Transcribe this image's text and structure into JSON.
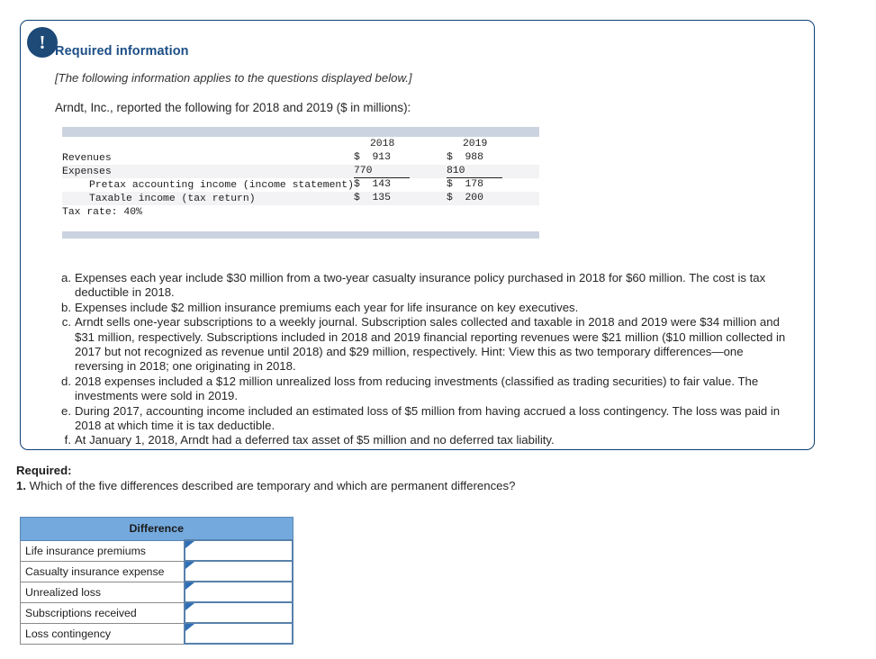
{
  "card": {
    "alert_icon": "exclamation-icon",
    "alert_glyph": "!",
    "heading": "Required information",
    "applies_note": "[The following information applies to the questions displayed below.]",
    "intro": "Arndt, Inc., reported the following for 2018 and 2019 ($ in millions):"
  },
  "fin_table": {
    "columns": [
      "",
      "2018",
      "2019"
    ],
    "rows": [
      {
        "label": "Revenues",
        "indent": 0,
        "y2018": "$  913",
        "y2019": "$  988",
        "underline": false
      },
      {
        "label": "Expenses",
        "indent": 0,
        "y2018": "770",
        "y2019": "810",
        "underline": true
      },
      {
        "label": "Pretax accounting income (income statement)",
        "indent": 1,
        "y2018": "$  143",
        "y2019": "$  178",
        "underline": false
      },
      {
        "label": "Taxable income (tax return)",
        "indent": 1,
        "y2018": "$  135",
        "y2019": "$  200",
        "underline": false
      },
      {
        "label": "Tax rate: 40%",
        "indent": 0,
        "y2018": "",
        "y2019": "",
        "underline": false
      }
    ]
  },
  "notes": [
    {
      "marker": "a.",
      "text": "Expenses each year include $30 million from a two-year casualty insurance policy purchased in 2018 for $60 million. The cost is tax deductible in 2018."
    },
    {
      "marker": "b.",
      "text": "Expenses include $2 million insurance premiums each year for life insurance on key executives."
    },
    {
      "marker": "c.",
      "text": "Arndt sells one-year subscriptions to a weekly journal. Subscription sales collected and taxable in 2018 and 2019 were $34 million and $31 million, respectively. Subscriptions included in 2018 and 2019 financial reporting revenues were $21 million ($10 million collected in 2017 but not recognized as revenue until 2018) and $29 million, respectively. Hint: View this as two temporary differences—one reversing in 2018; one originating in 2018."
    },
    {
      "marker": "d.",
      "text": "2018 expenses included a $12 million unrealized loss from reducing investments (classified as trading securities) to fair value. The investments were sold in 2019."
    },
    {
      "marker": "e.",
      "text": "During 2017, accounting income included an estimated loss of $5 million from having accrued a loss contingency. The loss was paid in 2018 at which time it is tax deductible."
    },
    {
      "marker": "f.",
      "text": "At January 1, 2018, Arndt had a deferred tax asset of $5 million and no deferred tax liability."
    }
  ],
  "required": {
    "label": "Required:",
    "question_number": "1.",
    "question_text": "Which of the five differences described are temporary and which are permanent differences?"
  },
  "answer_table": {
    "header": "Difference",
    "rows": [
      {
        "label": "Life insurance premiums",
        "value": ""
      },
      {
        "label": "Casualty insurance expense",
        "value": ""
      },
      {
        "label": "Unrealized loss",
        "value": ""
      },
      {
        "label": "Subscriptions received",
        "value": ""
      },
      {
        "label": "Loss contingency",
        "value": ""
      }
    ]
  },
  "colors": {
    "card_border": "#0d3f72",
    "badge": "#1d4a77",
    "heading": "#1c4e85",
    "table_band": "#ccd3e0",
    "answer_header": "#74a9dd",
    "answer_cell_border": "#5781ab"
  }
}
